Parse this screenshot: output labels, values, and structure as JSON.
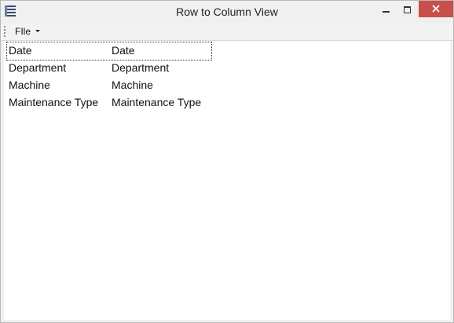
{
  "window": {
    "title": "Row to Column View"
  },
  "menubar": {
    "file_label": "FIle"
  },
  "table": {
    "rows": [
      [
        "Date",
        "Date"
      ],
      [
        "Department",
        "Department"
      ],
      [
        "Machine",
        "Machine"
      ],
      [
        "Maintenance Type",
        "Maintenance Type"
      ]
    ]
  },
  "icons": {
    "app": "list-icon",
    "minimize": "minimize-icon",
    "maximize": "maximize-icon",
    "close": "close-icon",
    "menu_caret": "chevron-down-icon"
  },
  "colors": {
    "close_button": "#c7504b",
    "window_bg": "#f0f0f0",
    "content_bg": "#ffffff"
  }
}
